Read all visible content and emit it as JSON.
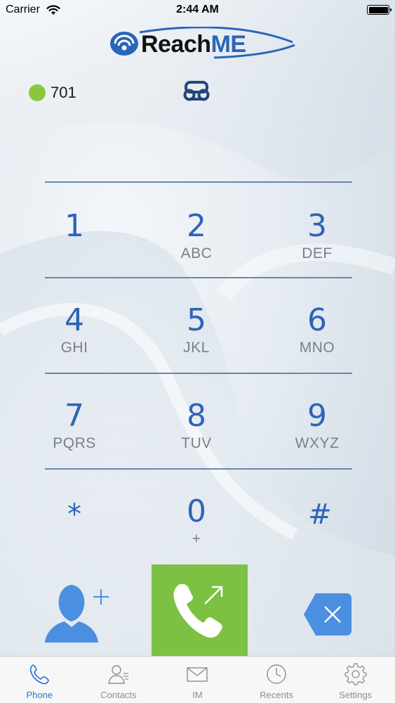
{
  "status_bar": {
    "carrier": "Carrier",
    "time": "2:44 AM"
  },
  "logo": {
    "text_main": "Reach",
    "text_accent": "ME",
    "brand_color": "#2966b8"
  },
  "account": {
    "number": "701",
    "status_color": "#8cc63f"
  },
  "dial_display": {
    "value": ""
  },
  "keypad": {
    "k1": {
      "digit": "1",
      "letters": ""
    },
    "k2": {
      "digit": "2",
      "letters": "ABC"
    },
    "k3": {
      "digit": "3",
      "letters": "DEF"
    },
    "k4": {
      "digit": "4",
      "letters": "GHI"
    },
    "k5": {
      "digit": "5",
      "letters": "JKL"
    },
    "k6": {
      "digit": "6",
      "letters": "MNO"
    },
    "k7": {
      "digit": "7",
      "letters": "PQRS"
    },
    "k8": {
      "digit": "8",
      "letters": "TUV"
    },
    "k9": {
      "digit": "9",
      "letters": "WXYZ"
    },
    "kstar": {
      "digit": "*",
      "letters": ""
    },
    "k0": {
      "digit": "0",
      "letters": "+"
    },
    "khash": {
      "digit": "#",
      "letters": ""
    }
  },
  "actions": {
    "call_color": "#7dc142",
    "accent_color": "#4a8fe0"
  },
  "tabs": [
    {
      "label": "Phone",
      "icon": "phone-icon",
      "active": true
    },
    {
      "label": "Contacts",
      "icon": "contacts-icon",
      "active": false
    },
    {
      "label": "IM",
      "icon": "envelope-icon",
      "active": false
    },
    {
      "label": "Recents",
      "icon": "clock-icon",
      "active": false
    },
    {
      "label": "Settings",
      "icon": "gear-icon",
      "active": false
    }
  ]
}
